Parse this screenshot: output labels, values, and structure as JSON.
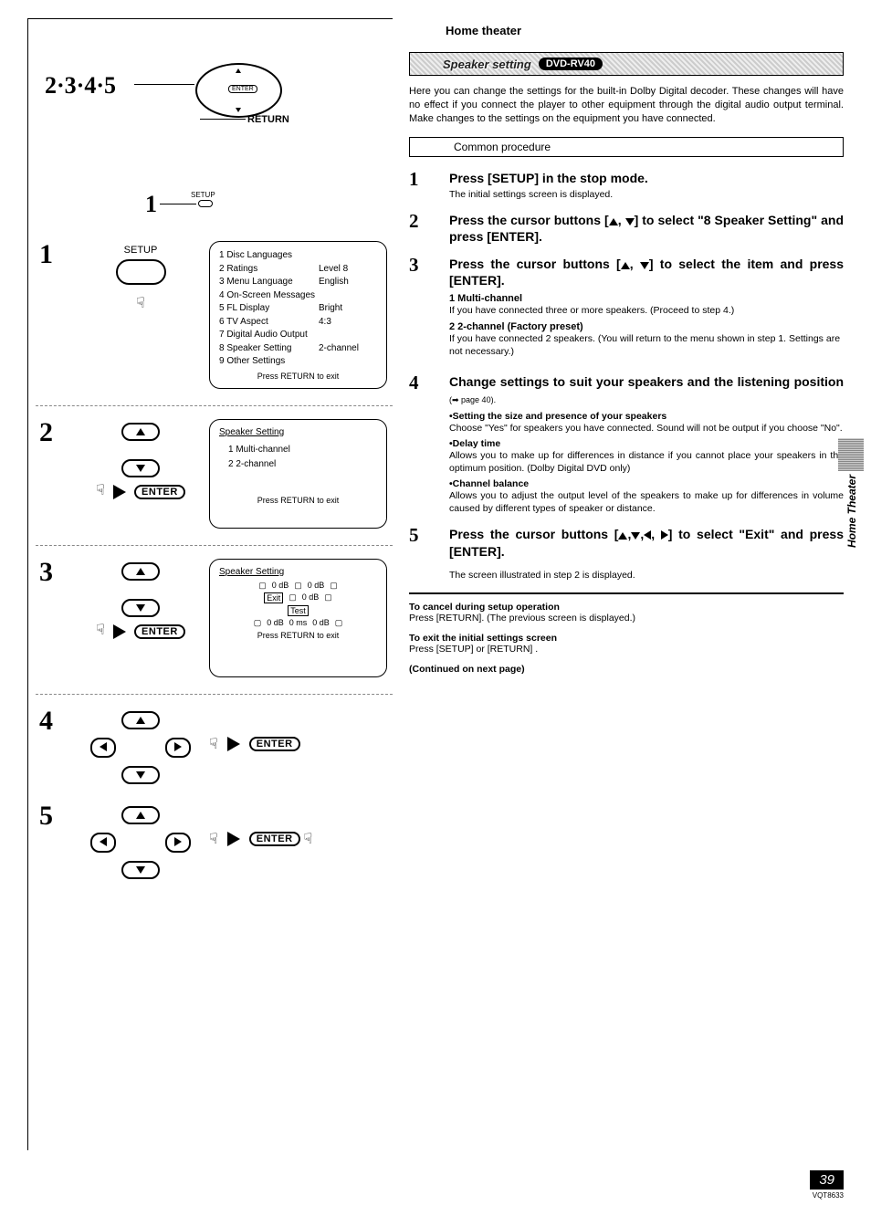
{
  "left": {
    "stepsLabel": "2·3·4·5",
    "returnLabel": "RETURN",
    "setupTiny": "SETUP",
    "oneLabel": "1",
    "setupLabel": "SETUP",
    "menu": {
      "items": [
        {
          "label": "1 Disc Languages",
          "value": ""
        },
        {
          "label": "2 Ratings",
          "value": "Level 8"
        },
        {
          "label": "3 Menu Language",
          "value": "English"
        },
        {
          "label": "4 On-Screen Messages",
          "value": ""
        },
        {
          "label": "5 FL Display",
          "value": "Bright"
        },
        {
          "label": "6 TV Aspect",
          "value": "4:3"
        },
        {
          "label": "7 Digital Audio Output",
          "value": ""
        },
        {
          "label": "8 Speaker Setting",
          "value": "2-channel"
        },
        {
          "label": "9 Other Settings",
          "value": ""
        }
      ],
      "footer": "Press RETURN to exit"
    },
    "enterBtn": "ENTER",
    "panel2": {
      "title": "Speaker Setting",
      "opt1": "1  Multi-channel",
      "opt2": "2  2-channel",
      "footer": "Press RETURN to exit"
    },
    "panel3": {
      "title": "Speaker Setting",
      "exit": "Exit",
      "test": "Test",
      "zeroDb": "0 dB",
      "zeroMs": "0 ms",
      "footer": "Press RETURN to exit"
    },
    "n1": "1",
    "n2": "2",
    "n3": "3",
    "n4": "4",
    "n5": "5"
  },
  "right": {
    "home": "Home theater",
    "bannerTitle": "Speaker setting",
    "bannerModel": "DVD-RV40",
    "intro": "Here you can change the settings for the built-in Dolby Digital decoder. These changes will have no effect if you connect the player to other equipment through the digital audio output terminal. Make changes to the settings on the equipment you have connected.",
    "common": "Common procedure",
    "s1": {
      "num": "1",
      "title": "Press [SETUP] in the stop mode.",
      "sub": "The initial settings screen is displayed."
    },
    "s2": {
      "num": "2",
      "title": "Press the cursor buttons [▲, ▼] to select \"8 Speaker Setting\" and press [ENTER]."
    },
    "s3": {
      "num": "3",
      "title": "Press the cursor buttons [▲, ▼] to select the item and press [ENTER].",
      "i1t": "1  Multi-channel",
      "i1d": "If you have connected three or more speakers. (Proceed to step 4.)",
      "i2t": "2  2-channel (Factory preset)",
      "i2d": "If you have connected 2 speakers. (You will return to the menu shown in step 1. Settings are not necessary.)"
    },
    "s4": {
      "num": "4",
      "title1": "Change settings to suit your speakers and the listening position",
      "pageRef": "(➡ page 40).",
      "b1t": "•Setting the size and presence of your speakers",
      "b1d": "Choose \"Yes\" for speakers you have connected. Sound will not be output if you choose \"No\".",
      "b2t": "•Delay time",
      "b2d": "Allows you to make up for differences in distance if you cannot place your speakers in the optimum position. (Dolby Digital DVD only)",
      "b3t": "•Channel balance",
      "b3d": "Allows you to adjust the output level of the speakers to make up for differences in volume caused by different types of speaker or distance."
    },
    "s5": {
      "num": "5",
      "title": "Press the cursor buttons [▲,▼,◀, ▶] to select \"Exit\" and press [ENTER].",
      "sub": "The screen illustrated in step 2 is displayed."
    },
    "cancel": {
      "h": "To cancel during setup operation",
      "d": "Press [RETURN]. (The previous screen is displayed.)"
    },
    "exit": {
      "h": "To exit the initial settings screen",
      "d": "Press [SETUP] or [RETURN] ."
    },
    "cont": "(Continued on next page)",
    "sideTab": "Home Theater"
  },
  "footer": {
    "page": "39",
    "code": "VQT8633"
  }
}
